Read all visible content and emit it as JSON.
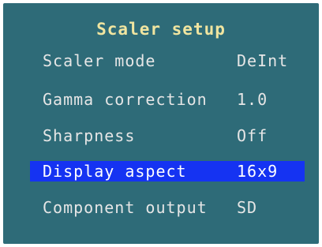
{
  "menu": {
    "title": "Scaler setup",
    "items": [
      {
        "label": "Scaler mode",
        "value": "DeInt"
      },
      {
        "label": "Gamma correction",
        "value": "1.0"
      },
      {
        "label": "Sharpness",
        "value": "Off"
      },
      {
        "label": "Display aspect",
        "value": "16x9",
        "selected": true
      },
      {
        "label": "Component output",
        "value": "SD"
      }
    ]
  },
  "colors": {
    "background": "#2e6b78",
    "title": "#f0e5a0",
    "text": "#e6e6e6",
    "selection": "#1533f2"
  }
}
